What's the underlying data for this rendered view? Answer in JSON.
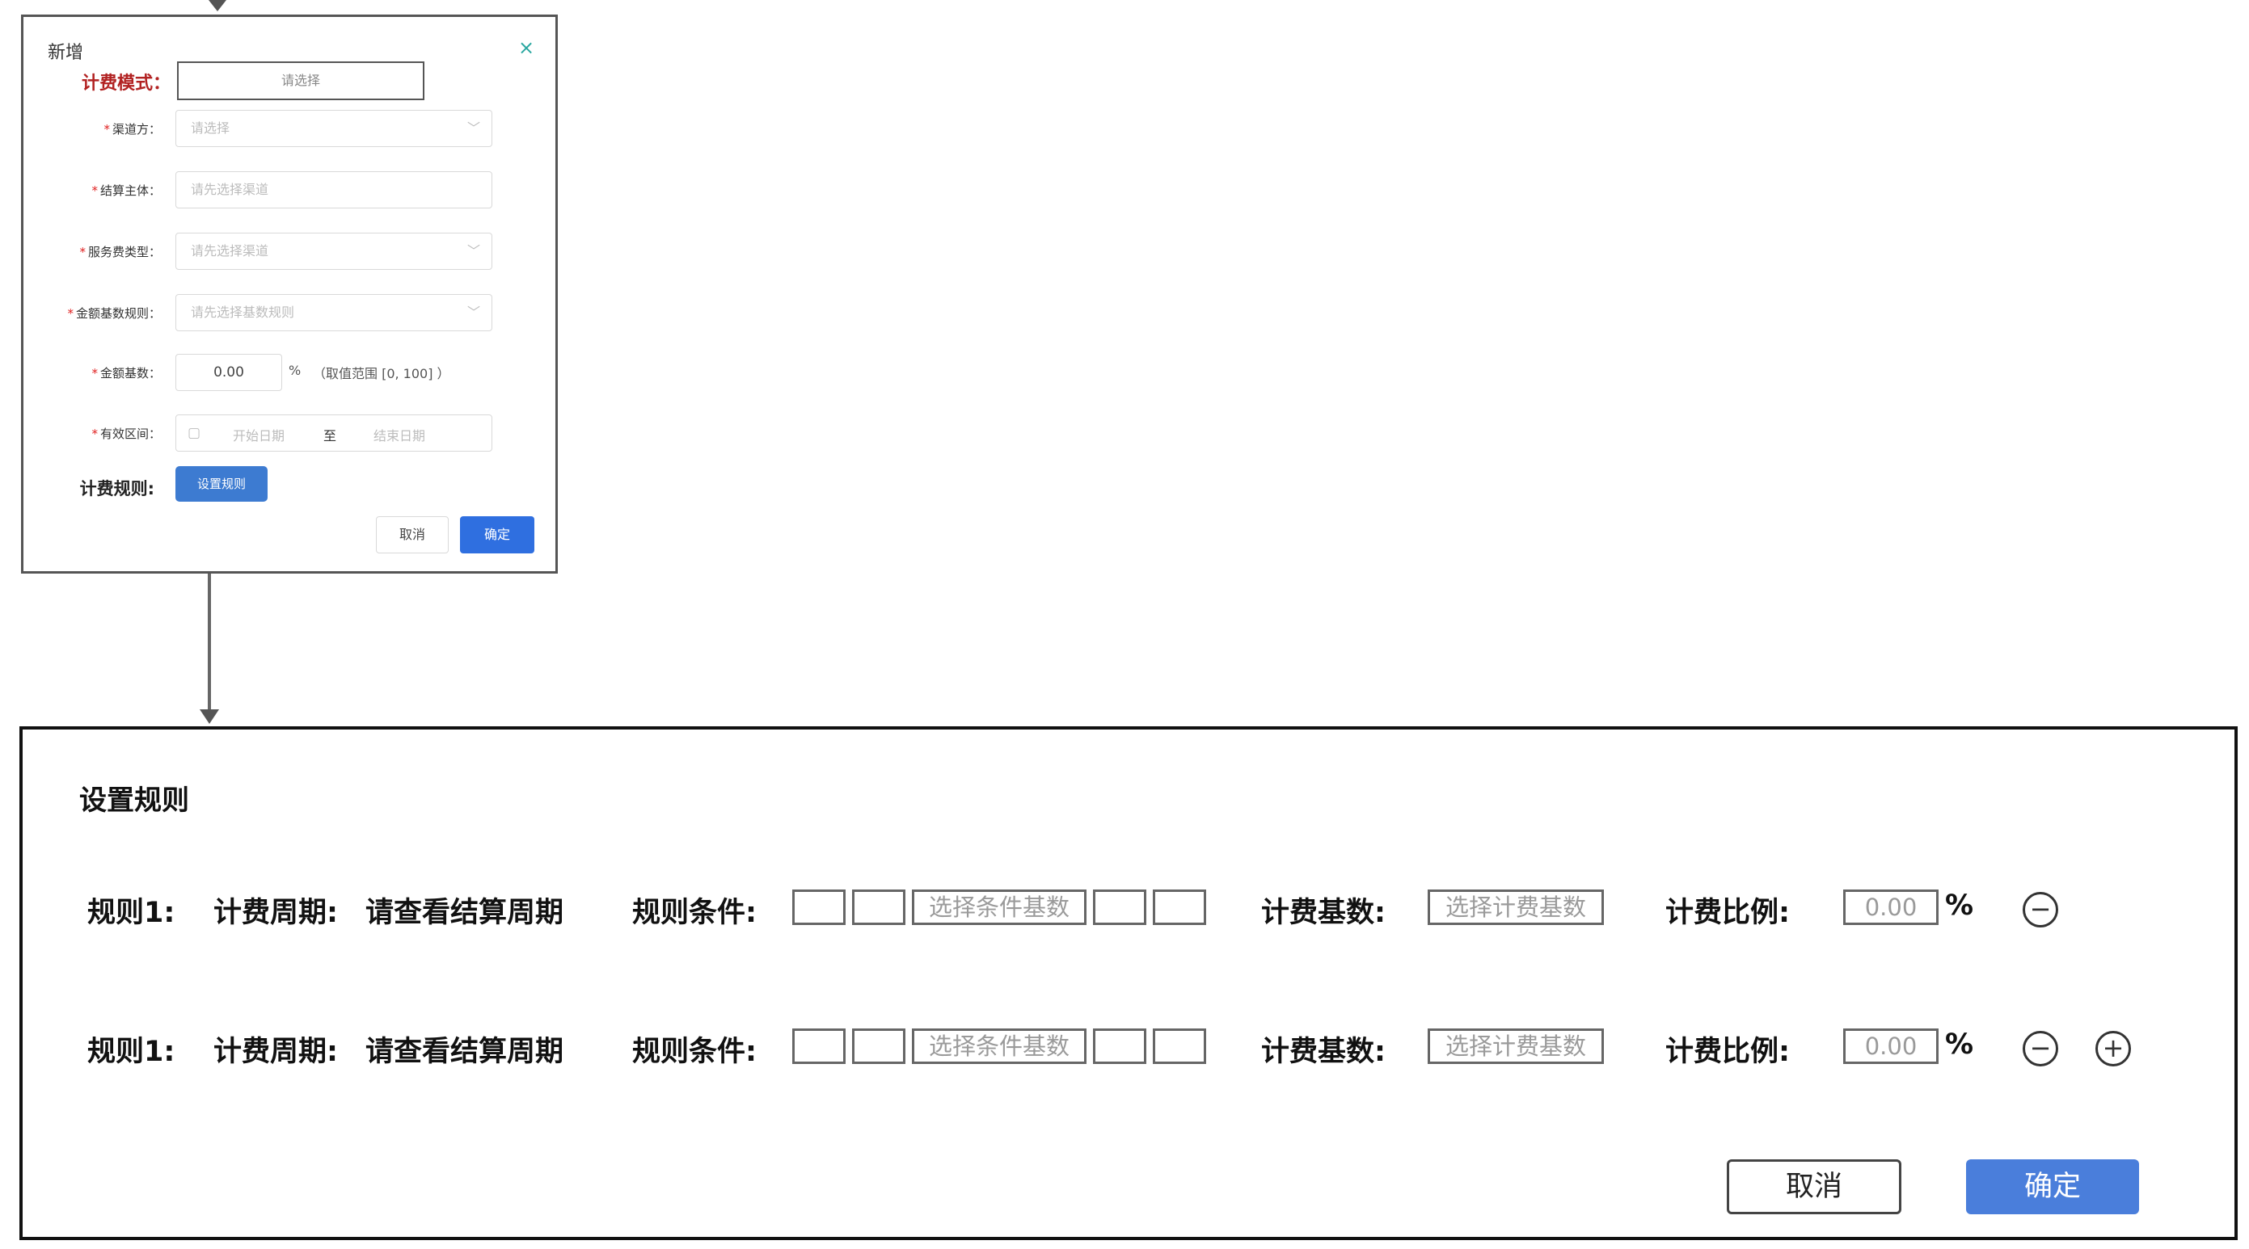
{
  "small_dialog": {
    "title": "新增",
    "close_icon": "×",
    "mode_label": "计费模式：",
    "mode_placeholder": "请选择",
    "channel_label": "渠道方：",
    "channel_placeholder": "请选择",
    "settlement_label": "结算主体：",
    "settlement_placeholder": "请先选择渠道",
    "service_label": "服务费类型：",
    "service_placeholder": "请先选择渠道",
    "base_rule_label": "金额基数规则：",
    "base_rule_placeholder": "请先选择基数规则",
    "base_label": "金额基数：",
    "base_value": "0.00",
    "percent_suffix": "%",
    "range_note": "（取值范围 [0, 100] ）",
    "validity_label": "有效区间：",
    "start_placeholder": "开始日期",
    "date_sep": "至",
    "end_placeholder": "结束日期",
    "rule_label": "计费规则:",
    "set_rule_button": "设置规则",
    "cancel": "取消",
    "confirm": "确定"
  },
  "panel": {
    "title": "设置规则",
    "rows": [
      {
        "rule": "规则1:",
        "cycle_label": "计费周期:",
        "cycle_value": "请查看结算周期",
        "cond_label": "规则条件:",
        "cond_placeholder": "选择条件基数",
        "base_label": "计费基数:",
        "base_placeholder": "选择计费基数",
        "ratio_label": "计费比例:",
        "ratio_value": "0.00",
        "percent": "%",
        "remove_icon": "−"
      },
      {
        "rule": "规则1:",
        "cycle_label": "计费周期:",
        "cycle_value": "请查看结算周期",
        "cond_label": "规则条件:",
        "cond_placeholder": "选择条件基数",
        "base_label": "计费基数:",
        "base_placeholder": "选择计费基数",
        "ratio_label": "计费比例:",
        "ratio_value": "0.00",
        "percent": "%",
        "remove_icon": "−",
        "add_icon": "+"
      }
    ],
    "cancel": "取消",
    "confirm": "确定"
  }
}
